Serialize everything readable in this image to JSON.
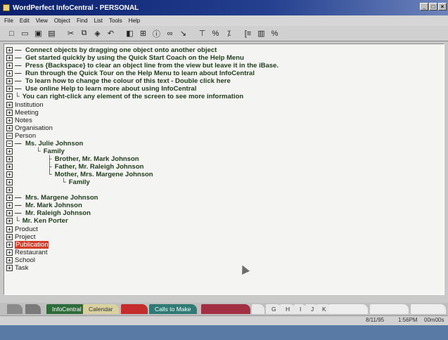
{
  "window": {
    "title": "WordPerfect InfoCentral - PERSONAL"
  },
  "menu": [
    "File",
    "Edit",
    "View",
    "Object",
    "Find",
    "List",
    "Tools",
    "Help"
  ],
  "tips": [
    "Connect objects by dragging one object onto another object",
    "Get started quickly by using the Quick Start Coach on the Help Menu",
    "Press {Backspace} to clear an object line from the view but leave it in the iBase.",
    "Run through the Quick Tour on the Help Menu to learn about InfoCentral",
    "To learn how to change the colour of this text - Double click here",
    "Use online Help to learn more about using InfoCentral",
    "You can right-click any element of the screen to see more information"
  ],
  "categories": {
    "institution": "Institution",
    "meeting": "Meeting",
    "notes": "Notes",
    "organisation": "Organisation",
    "person": "Person",
    "product": "Product",
    "project": "Project",
    "publication": "Publication",
    "restaurant": "Restaurant",
    "school": "School",
    "task": "Task"
  },
  "person_items": {
    "julie": "Ms. Julie Johnson",
    "family": "Family",
    "brother": "Brother, Mr. Mark Johnson",
    "father": "Father, Mr. Raleigh Johnson",
    "mother": "Mother, Mrs. Margene Johnson",
    "mother_family": "Family",
    "margene": "Mrs. Margene Johnson",
    "mark": "Mr. Mark Johnson",
    "raleigh": "Mr. Raleigh Johnson",
    "ken": "Mr. Ken Porter"
  },
  "tabs": {
    "infocentral": "InfoCentral",
    "calendar": "Calendar",
    "calls": "Calls to Make",
    "g": "G",
    "h": "H",
    "i": "I",
    "j": "J",
    "k": "K"
  },
  "status": {
    "date": "8/11/95",
    "time": "1:56PM",
    "mem": "00m00s"
  }
}
